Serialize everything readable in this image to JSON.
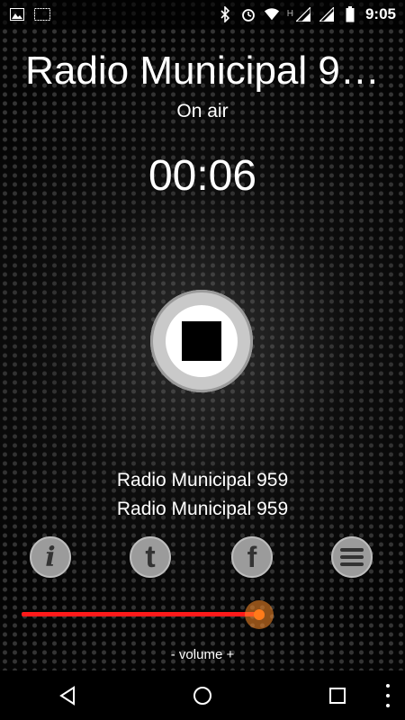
{
  "status_bar": {
    "time": "9:05",
    "network_label": "H",
    "icons": [
      "gallery-icon",
      "sms-icon",
      "bluetooth-icon",
      "alarm-icon",
      "wifi-icon",
      "signal-icon",
      "signal-icon",
      "battery-icon"
    ]
  },
  "header": {
    "title": "Radio Municipal 9…",
    "status": "On air"
  },
  "player": {
    "elapsed": "00:06",
    "track_line1": "Radio Municipal 959",
    "track_line2": "Radio Municipal 959"
  },
  "actions": {
    "info_glyph": "i",
    "twitter_glyph": "t",
    "facebook_glyph": "f"
  },
  "volume": {
    "label": "- volume +",
    "level": 0.88
  },
  "colors": {
    "accent_track": "#ff1a1a",
    "thumb": "#ff7b1a"
  }
}
